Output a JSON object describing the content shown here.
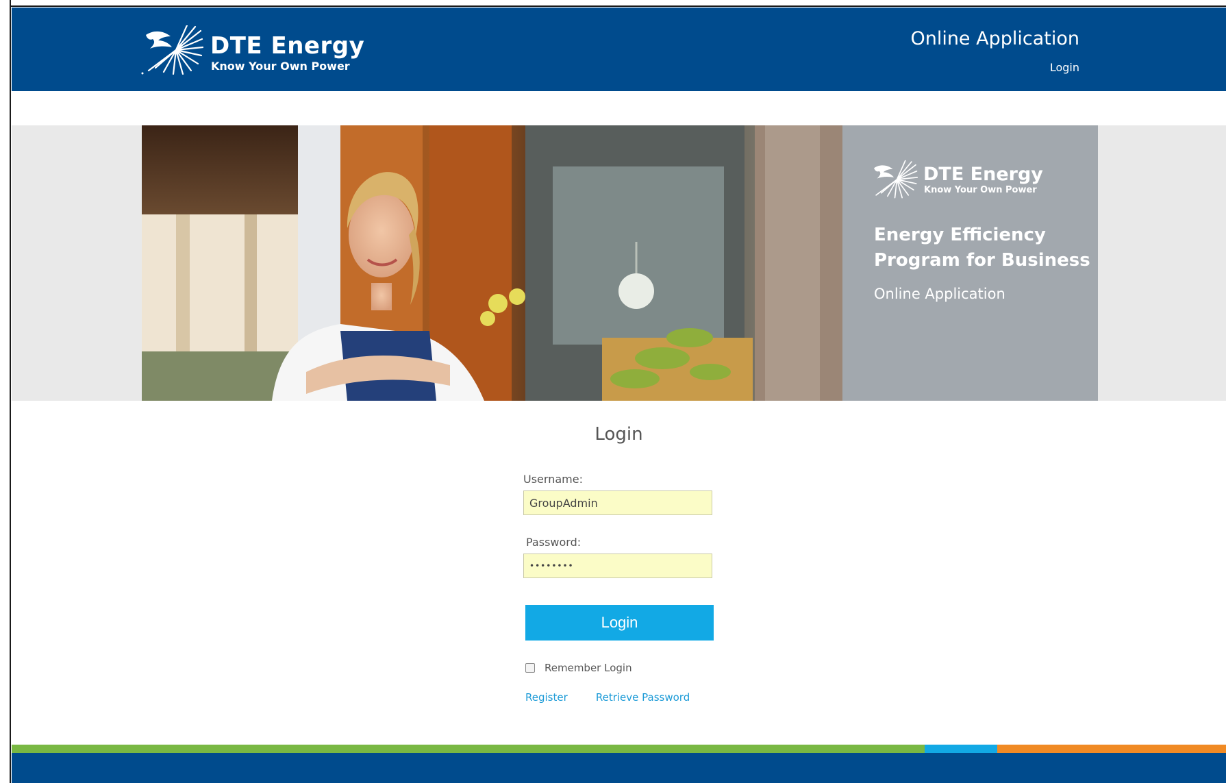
{
  "header": {
    "brand_name": "DTE Energy",
    "brand_tagline": "Know Your Own Power",
    "app_title": "Online Application",
    "login_link": "Login"
  },
  "banner": {
    "brand_name": "DTE Energy",
    "brand_tagline": "Know Your Own Power",
    "heading_line1": "Energy Efficiency",
    "heading_line2": "Program for Business",
    "subheading": "Online Application"
  },
  "login": {
    "title": "Login",
    "username_label": "Username:",
    "username_value": "GroupAdmin",
    "password_label": "Password:",
    "password_value": "••••••••",
    "submit_label": "Login",
    "remember_label": "Remember Login",
    "remember_checked": false,
    "register_link": "Register",
    "retrieve_link": "Retrieve Password"
  },
  "colors": {
    "brand_blue": "#004b8d",
    "button_blue": "#12a9e5",
    "input_fill": "#fbfcc7",
    "stripe_green": "#79b843",
    "stripe_blue": "#12a9e5",
    "stripe_orange": "#f08a24",
    "panel_grey": "#a2a8ae"
  },
  "icons": [
    "dte-sunburst-logo-icon"
  ]
}
